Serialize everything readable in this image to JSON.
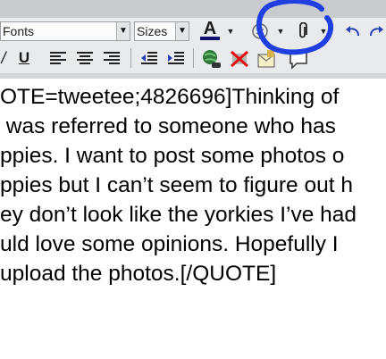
{
  "toolbar": {
    "font_select": "Fonts",
    "size_select": "Sizes",
    "text_color_label": "A",
    "highlight_color": "#2233aa"
  },
  "editor": {
    "lines": [
      "OTE=tweetee;4826696]Thinking of",
      " was referred to someone who has",
      "ppies. I want to post some photos o",
      "ppies but I can’t seem to figure out h",
      "ey don’t look like the yorkies I’ve had",
      "uld love some opinions. Hopefully I",
      "upload the photos.[/QUOTE]"
    ]
  },
  "annotation": {
    "color": "#1f3fe0",
    "target": "attachment-button"
  }
}
